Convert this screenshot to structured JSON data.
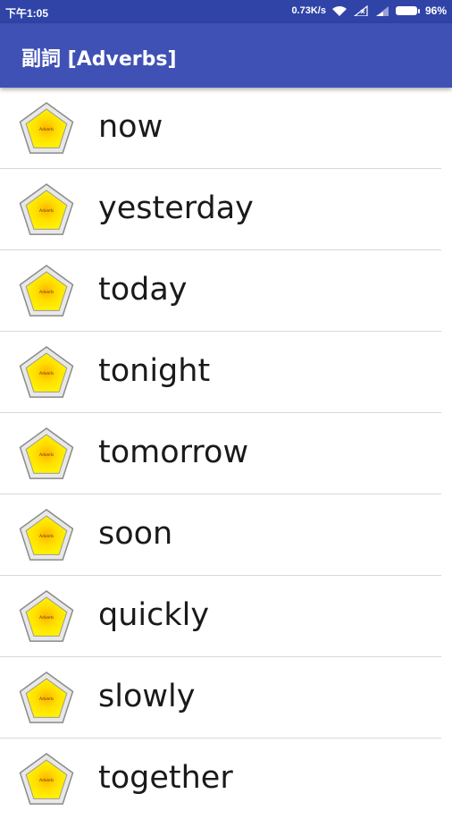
{
  "status_bar": {
    "time": "下午1:05",
    "network_speed": "0.73K/s",
    "battery": "96%",
    "battery_level": 0.96,
    "icons": [
      "wifi-icon",
      "no-sim-signal-icon",
      "cell-signal-icon",
      "battery-icon"
    ]
  },
  "app_bar": {
    "title": "副詞 [Adverbs]",
    "color": "#3f51b5"
  },
  "list": {
    "item_icon": "adverb-pentagon-icon",
    "icon_label": "Adverb",
    "items": [
      {
        "word": "now"
      },
      {
        "word": "yesterday"
      },
      {
        "word": "today"
      },
      {
        "word": "tonight"
      },
      {
        "word": "tomorrow"
      },
      {
        "word": "soon"
      },
      {
        "word": "quickly"
      },
      {
        "word": "slowly"
      },
      {
        "word": "together"
      }
    ]
  }
}
